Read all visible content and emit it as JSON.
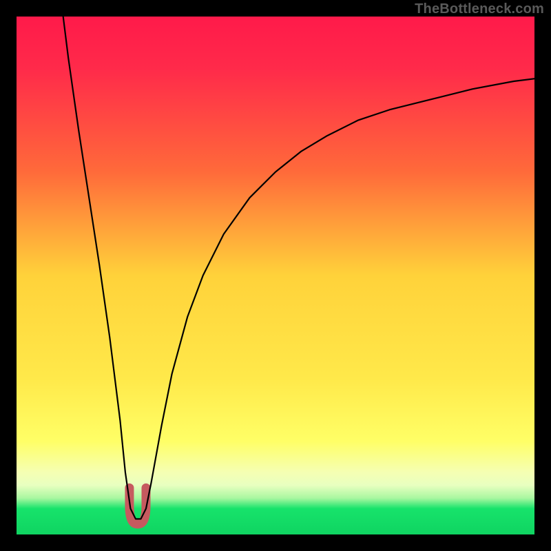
{
  "watermark": "TheBottleneck.com",
  "colors": {
    "frame": "#000000",
    "gradient_top": "#ff1a4a",
    "gradient_mid1": "#ff7a2a",
    "gradient_mid2": "#ffd23a",
    "gradient_mid3": "#ffff66",
    "gradient_band": "#f5ffb3",
    "gradient_green": "#17e36b",
    "curve": "#000000",
    "highlight": "#c65a5f"
  },
  "chart_data": {
    "type": "line",
    "title": "",
    "xlabel": "",
    "ylabel": "",
    "xlim": [
      0,
      100
    ],
    "ylim": [
      0,
      100
    ],
    "grid": false,
    "legend": false,
    "annotations": [],
    "series": [
      {
        "name": "curve",
        "x": [
          9,
          10,
          12,
          14,
          16,
          18,
          19,
          20,
          21,
          22,
          23,
          24,
          25,
          26,
          28,
          30,
          33,
          36,
          40,
          45,
          50,
          55,
          60,
          66,
          72,
          80,
          88,
          96,
          100
        ],
        "y": [
          100,
          92,
          78,
          65,
          52,
          38,
          30,
          22,
          12,
          5,
          3,
          3,
          5,
          10,
          21,
          31,
          42,
          50,
          58,
          65,
          70,
          74,
          77,
          80,
          82,
          84,
          86,
          87.5,
          88
        ]
      }
    ],
    "highlight_region": {
      "name": "minimum-band",
      "x_range": [
        21.8,
        25.0
      ],
      "y_range": [
        2,
        9
      ]
    }
  }
}
